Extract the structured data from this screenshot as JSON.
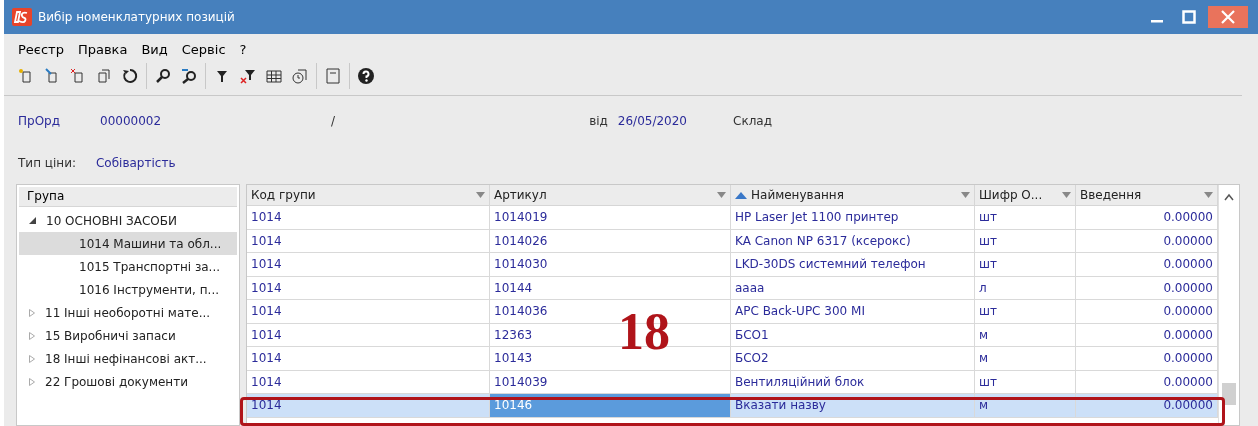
{
  "window": {
    "title": "Вибір номенклатурних позицій"
  },
  "menu": [
    "Реєстр",
    "Правка",
    "Вид",
    "Сервіс",
    "?"
  ],
  "toolbar": [
    {
      "kind": "new"
    },
    {
      "kind": "edit"
    },
    {
      "kind": "delete"
    },
    {
      "kind": "copy"
    },
    {
      "kind": "refresh"
    },
    {
      "kind": "sep"
    },
    {
      "kind": "find"
    },
    {
      "kind": "findnext"
    },
    {
      "kind": "sep"
    },
    {
      "kind": "filter"
    },
    {
      "kind": "clearfilter"
    },
    {
      "kind": "table"
    },
    {
      "kind": "history"
    },
    {
      "kind": "sep"
    },
    {
      "kind": "form"
    },
    {
      "kind": "sep"
    },
    {
      "kind": "help"
    }
  ],
  "header": {
    "doc_type": "ПрОрд",
    "number": "00000002",
    "slash": "/",
    "date_label": "від",
    "date": "26/05/2020",
    "warehouse_label": "Склад",
    "price_label": "Тип ціни:",
    "price_value": "Собівартість"
  },
  "tree": {
    "title": "Група",
    "items": [
      {
        "label": "10 ОСНОВНІ ЗАСОБИ",
        "expanded": true,
        "selected": false,
        "children": [
          {
            "label": "1014 Машини та обл...",
            "selected": true
          },
          {
            "label": "1015 Транспортні за...",
            "selected": false
          },
          {
            "label": "1016 Інструменти, п...",
            "selected": false
          }
        ]
      },
      {
        "label": "11 Інші необоротні мате...",
        "expanded": false,
        "selected": false
      },
      {
        "label": "15 Виробничі запаси",
        "expanded": false,
        "selected": false
      },
      {
        "label": "18 Інші нефінансові акт...",
        "expanded": false,
        "selected": false
      },
      {
        "label": "22 Грошові документи",
        "expanded": false,
        "selected": false
      }
    ]
  },
  "table": {
    "columns": [
      {
        "label": "Код групи",
        "sorted": false
      },
      {
        "label": "Артикул",
        "sorted": false
      },
      {
        "label": "Найменування",
        "sorted": true
      },
      {
        "label": "Шифр О...",
        "sorted": false
      },
      {
        "label": "Введення",
        "sorted": false
      }
    ],
    "rows": [
      {
        "cells": [
          "1014",
          "1014019",
          "HP Laser Jet 1100 принтер",
          "шт",
          "0.00000"
        ],
        "selected": false
      },
      {
        "cells": [
          "1014",
          "1014026",
          "KA Canon NP 6317 (ксерокс)",
          "шт",
          "0.00000"
        ],
        "selected": false
      },
      {
        "cells": [
          "1014",
          "1014030",
          "LKD-30DS системний телефон",
          "шт",
          "0.00000"
        ],
        "selected": false
      },
      {
        "cells": [
          "1014",
          "10144",
          "аааа",
          "л",
          "0.00000"
        ],
        "selected": false
      },
      {
        "cells": [
          "1014",
          "1014036",
          "APC Back-UPC 300 MI",
          "шт",
          "0.00000"
        ],
        "selected": false
      },
      {
        "cells": [
          "1014",
          "12363",
          "БСО1",
          "м",
          "0.00000"
        ],
        "selected": false
      },
      {
        "cells": [
          "1014",
          "10143",
          "БСО2",
          "м",
          "0.00000"
        ],
        "selected": false
      },
      {
        "cells": [
          "1014",
          "1014039",
          "Вентиляційний блок",
          "шт",
          "0.00000"
        ],
        "selected": false
      },
      {
        "cells": [
          "1014",
          "10146",
          "Вказати назву",
          "м",
          "0.00000"
        ],
        "selected": true
      }
    ]
  },
  "annotation": {
    "label": "18"
  }
}
